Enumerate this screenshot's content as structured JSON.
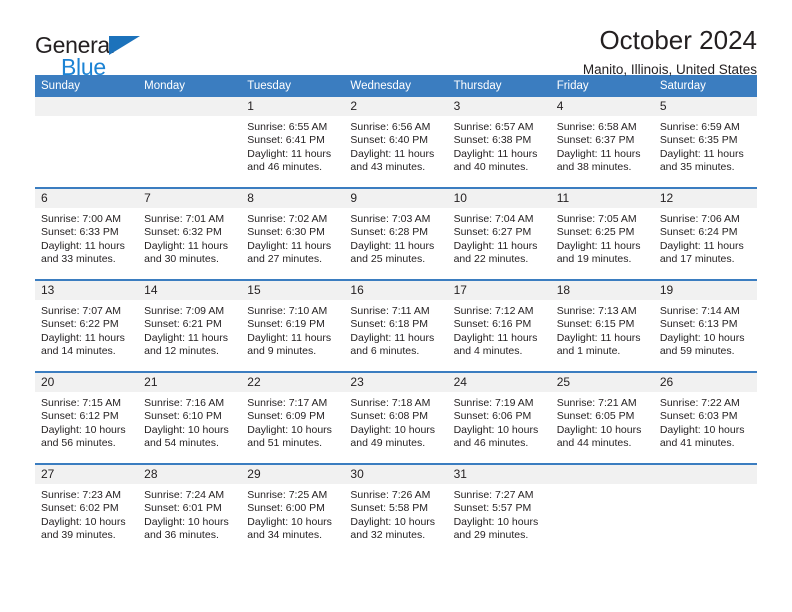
{
  "brand": {
    "name_top": "General",
    "name_bottom": "Blue",
    "accent_color": "#1c83d4",
    "triangle_color": "#1c72bb"
  },
  "header": {
    "month_title": "October 2024",
    "location": "Manito, Illinois, United States"
  },
  "calendar": {
    "header_bg": "#3b7dc0",
    "header_text_color": "#ffffff",
    "daynum_bg": "#f1f1f1",
    "weekday_headers": [
      "Sunday",
      "Monday",
      "Tuesday",
      "Wednesday",
      "Thursday",
      "Friday",
      "Saturday"
    ],
    "weeks": [
      [
        {
          "day": "",
          "sunrise": "",
          "sunset": "",
          "daylight_line1": "",
          "daylight_line2": ""
        },
        {
          "day": "",
          "sunrise": "",
          "sunset": "",
          "daylight_line1": "",
          "daylight_line2": ""
        },
        {
          "day": "1",
          "sunrise": "Sunrise: 6:55 AM",
          "sunset": "Sunset: 6:41 PM",
          "daylight_line1": "Daylight: 11 hours",
          "daylight_line2": "and 46 minutes."
        },
        {
          "day": "2",
          "sunrise": "Sunrise: 6:56 AM",
          "sunset": "Sunset: 6:40 PM",
          "daylight_line1": "Daylight: 11 hours",
          "daylight_line2": "and 43 minutes."
        },
        {
          "day": "3",
          "sunrise": "Sunrise: 6:57 AM",
          "sunset": "Sunset: 6:38 PM",
          "daylight_line1": "Daylight: 11 hours",
          "daylight_line2": "and 40 minutes."
        },
        {
          "day": "4",
          "sunrise": "Sunrise: 6:58 AM",
          "sunset": "Sunset: 6:37 PM",
          "daylight_line1": "Daylight: 11 hours",
          "daylight_line2": "and 38 minutes."
        },
        {
          "day": "5",
          "sunrise": "Sunrise: 6:59 AM",
          "sunset": "Sunset: 6:35 PM",
          "daylight_line1": "Daylight: 11 hours",
          "daylight_line2": "and 35 minutes."
        }
      ],
      [
        {
          "day": "6",
          "sunrise": "Sunrise: 7:00 AM",
          "sunset": "Sunset: 6:33 PM",
          "daylight_line1": "Daylight: 11 hours",
          "daylight_line2": "and 33 minutes."
        },
        {
          "day": "7",
          "sunrise": "Sunrise: 7:01 AM",
          "sunset": "Sunset: 6:32 PM",
          "daylight_line1": "Daylight: 11 hours",
          "daylight_line2": "and 30 minutes."
        },
        {
          "day": "8",
          "sunrise": "Sunrise: 7:02 AM",
          "sunset": "Sunset: 6:30 PM",
          "daylight_line1": "Daylight: 11 hours",
          "daylight_line2": "and 27 minutes."
        },
        {
          "day": "9",
          "sunrise": "Sunrise: 7:03 AM",
          "sunset": "Sunset: 6:28 PM",
          "daylight_line1": "Daylight: 11 hours",
          "daylight_line2": "and 25 minutes."
        },
        {
          "day": "10",
          "sunrise": "Sunrise: 7:04 AM",
          "sunset": "Sunset: 6:27 PM",
          "daylight_line1": "Daylight: 11 hours",
          "daylight_line2": "and 22 minutes."
        },
        {
          "day": "11",
          "sunrise": "Sunrise: 7:05 AM",
          "sunset": "Sunset: 6:25 PM",
          "daylight_line1": "Daylight: 11 hours",
          "daylight_line2": "and 19 minutes."
        },
        {
          "day": "12",
          "sunrise": "Sunrise: 7:06 AM",
          "sunset": "Sunset: 6:24 PM",
          "daylight_line1": "Daylight: 11 hours",
          "daylight_line2": "and 17 minutes."
        }
      ],
      [
        {
          "day": "13",
          "sunrise": "Sunrise: 7:07 AM",
          "sunset": "Sunset: 6:22 PM",
          "daylight_line1": "Daylight: 11 hours",
          "daylight_line2": "and 14 minutes."
        },
        {
          "day": "14",
          "sunrise": "Sunrise: 7:09 AM",
          "sunset": "Sunset: 6:21 PM",
          "daylight_line1": "Daylight: 11 hours",
          "daylight_line2": "and 12 minutes."
        },
        {
          "day": "15",
          "sunrise": "Sunrise: 7:10 AM",
          "sunset": "Sunset: 6:19 PM",
          "daylight_line1": "Daylight: 11 hours",
          "daylight_line2": "and 9 minutes."
        },
        {
          "day": "16",
          "sunrise": "Sunrise: 7:11 AM",
          "sunset": "Sunset: 6:18 PM",
          "daylight_line1": "Daylight: 11 hours",
          "daylight_line2": "and 6 minutes."
        },
        {
          "day": "17",
          "sunrise": "Sunrise: 7:12 AM",
          "sunset": "Sunset: 6:16 PM",
          "daylight_line1": "Daylight: 11 hours",
          "daylight_line2": "and 4 minutes."
        },
        {
          "day": "18",
          "sunrise": "Sunrise: 7:13 AM",
          "sunset": "Sunset: 6:15 PM",
          "daylight_line1": "Daylight: 11 hours",
          "daylight_line2": "and 1 minute."
        },
        {
          "day": "19",
          "sunrise": "Sunrise: 7:14 AM",
          "sunset": "Sunset: 6:13 PM",
          "daylight_line1": "Daylight: 10 hours",
          "daylight_line2": "and 59 minutes."
        }
      ],
      [
        {
          "day": "20",
          "sunrise": "Sunrise: 7:15 AM",
          "sunset": "Sunset: 6:12 PM",
          "daylight_line1": "Daylight: 10 hours",
          "daylight_line2": "and 56 minutes."
        },
        {
          "day": "21",
          "sunrise": "Sunrise: 7:16 AM",
          "sunset": "Sunset: 6:10 PM",
          "daylight_line1": "Daylight: 10 hours",
          "daylight_line2": "and 54 minutes."
        },
        {
          "day": "22",
          "sunrise": "Sunrise: 7:17 AM",
          "sunset": "Sunset: 6:09 PM",
          "daylight_line1": "Daylight: 10 hours",
          "daylight_line2": "and 51 minutes."
        },
        {
          "day": "23",
          "sunrise": "Sunrise: 7:18 AM",
          "sunset": "Sunset: 6:08 PM",
          "daylight_line1": "Daylight: 10 hours",
          "daylight_line2": "and 49 minutes."
        },
        {
          "day": "24",
          "sunrise": "Sunrise: 7:19 AM",
          "sunset": "Sunset: 6:06 PM",
          "daylight_line1": "Daylight: 10 hours",
          "daylight_line2": "and 46 minutes."
        },
        {
          "day": "25",
          "sunrise": "Sunrise: 7:21 AM",
          "sunset": "Sunset: 6:05 PM",
          "daylight_line1": "Daylight: 10 hours",
          "daylight_line2": "and 44 minutes."
        },
        {
          "day": "26",
          "sunrise": "Sunrise: 7:22 AM",
          "sunset": "Sunset: 6:03 PM",
          "daylight_line1": "Daylight: 10 hours",
          "daylight_line2": "and 41 minutes."
        }
      ],
      [
        {
          "day": "27",
          "sunrise": "Sunrise: 7:23 AM",
          "sunset": "Sunset: 6:02 PM",
          "daylight_line1": "Daylight: 10 hours",
          "daylight_line2": "and 39 minutes."
        },
        {
          "day": "28",
          "sunrise": "Sunrise: 7:24 AM",
          "sunset": "Sunset: 6:01 PM",
          "daylight_line1": "Daylight: 10 hours",
          "daylight_line2": "and 36 minutes."
        },
        {
          "day": "29",
          "sunrise": "Sunrise: 7:25 AM",
          "sunset": "Sunset: 6:00 PM",
          "daylight_line1": "Daylight: 10 hours",
          "daylight_line2": "and 34 minutes."
        },
        {
          "day": "30",
          "sunrise": "Sunrise: 7:26 AM",
          "sunset": "Sunset: 5:58 PM",
          "daylight_line1": "Daylight: 10 hours",
          "daylight_line2": "and 32 minutes."
        },
        {
          "day": "31",
          "sunrise": "Sunrise: 7:27 AM",
          "sunset": "Sunset: 5:57 PM",
          "daylight_line1": "Daylight: 10 hours",
          "daylight_line2": "and 29 minutes."
        },
        {
          "day": "",
          "sunrise": "",
          "sunset": "",
          "daylight_line1": "",
          "daylight_line2": ""
        },
        {
          "day": "",
          "sunrise": "",
          "sunset": "",
          "daylight_line1": "",
          "daylight_line2": ""
        }
      ]
    ]
  }
}
